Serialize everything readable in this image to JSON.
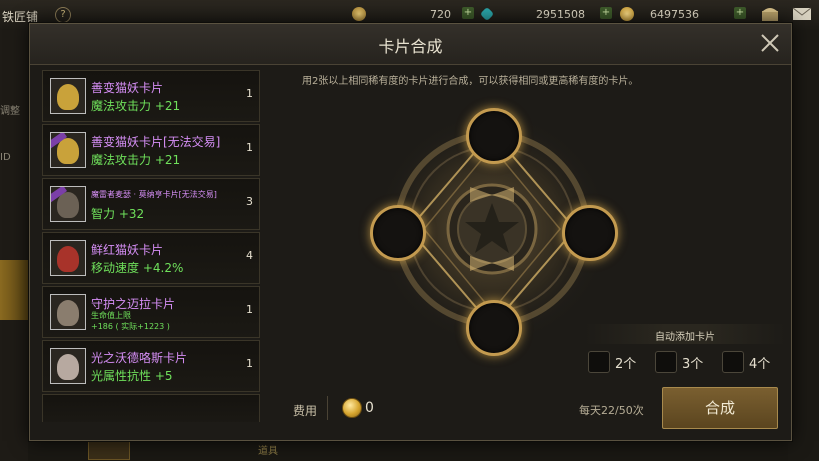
{
  "topbar": {
    "shop_name": "铁匠铺",
    "help": "?",
    "currency1": "720",
    "currency2": "2951508",
    "currency3": "6497536",
    "plus": "+"
  },
  "side": {
    "tab1": "调整",
    "tab2": "ID"
  },
  "modal": {
    "title": "卡片合成",
    "hint": "用2张以上相同稀有度的卡片进行合成，可以获得相同或更高稀有度的卡片。",
    "auto_add_label": "自动添加卡片",
    "options": [
      "2个",
      "3个",
      "4个"
    ],
    "cost_label": "费用",
    "cost_value": "0",
    "daily_limit": "每天22/50次",
    "synth_button": "合成"
  },
  "cards": [
    {
      "name": "善变猫妖卡片",
      "stat": "魔法攻击力 +21",
      "count": "1",
      "tradable_tag": false
    },
    {
      "name": "善变猫妖卡片[无法交易]",
      "stat": "魔法攻击力 +21",
      "count": "1",
      "tradable_tag": true
    },
    {
      "name": "魔雷者麦瑟 · 莫纳亨卡片[无法交易]",
      "stat": "智力 +32",
      "count": "3",
      "tradable_tag": true
    },
    {
      "name": "鲜红猫妖卡片",
      "stat": "移动速度 +4.2%",
      "count": "4",
      "tradable_tag": false
    },
    {
      "name": "守护之迈拉卡片",
      "stat_line1": "生命值上限",
      "stat_line2": "+186 ( 实际+1223 )",
      "count": "1",
      "tradable_tag": false
    },
    {
      "name": "光之沃德咯斯卡片",
      "stat": "光属性抗性 +5",
      "count": "1",
      "tradable_tag": false
    }
  ],
  "bottom": {
    "label": "道具"
  },
  "colors": {
    "card_name": "#d58ef5",
    "card_stat": "#6fe05b",
    "slot_ring": "#c39a4f",
    "button_bg": "#6b5228"
  }
}
